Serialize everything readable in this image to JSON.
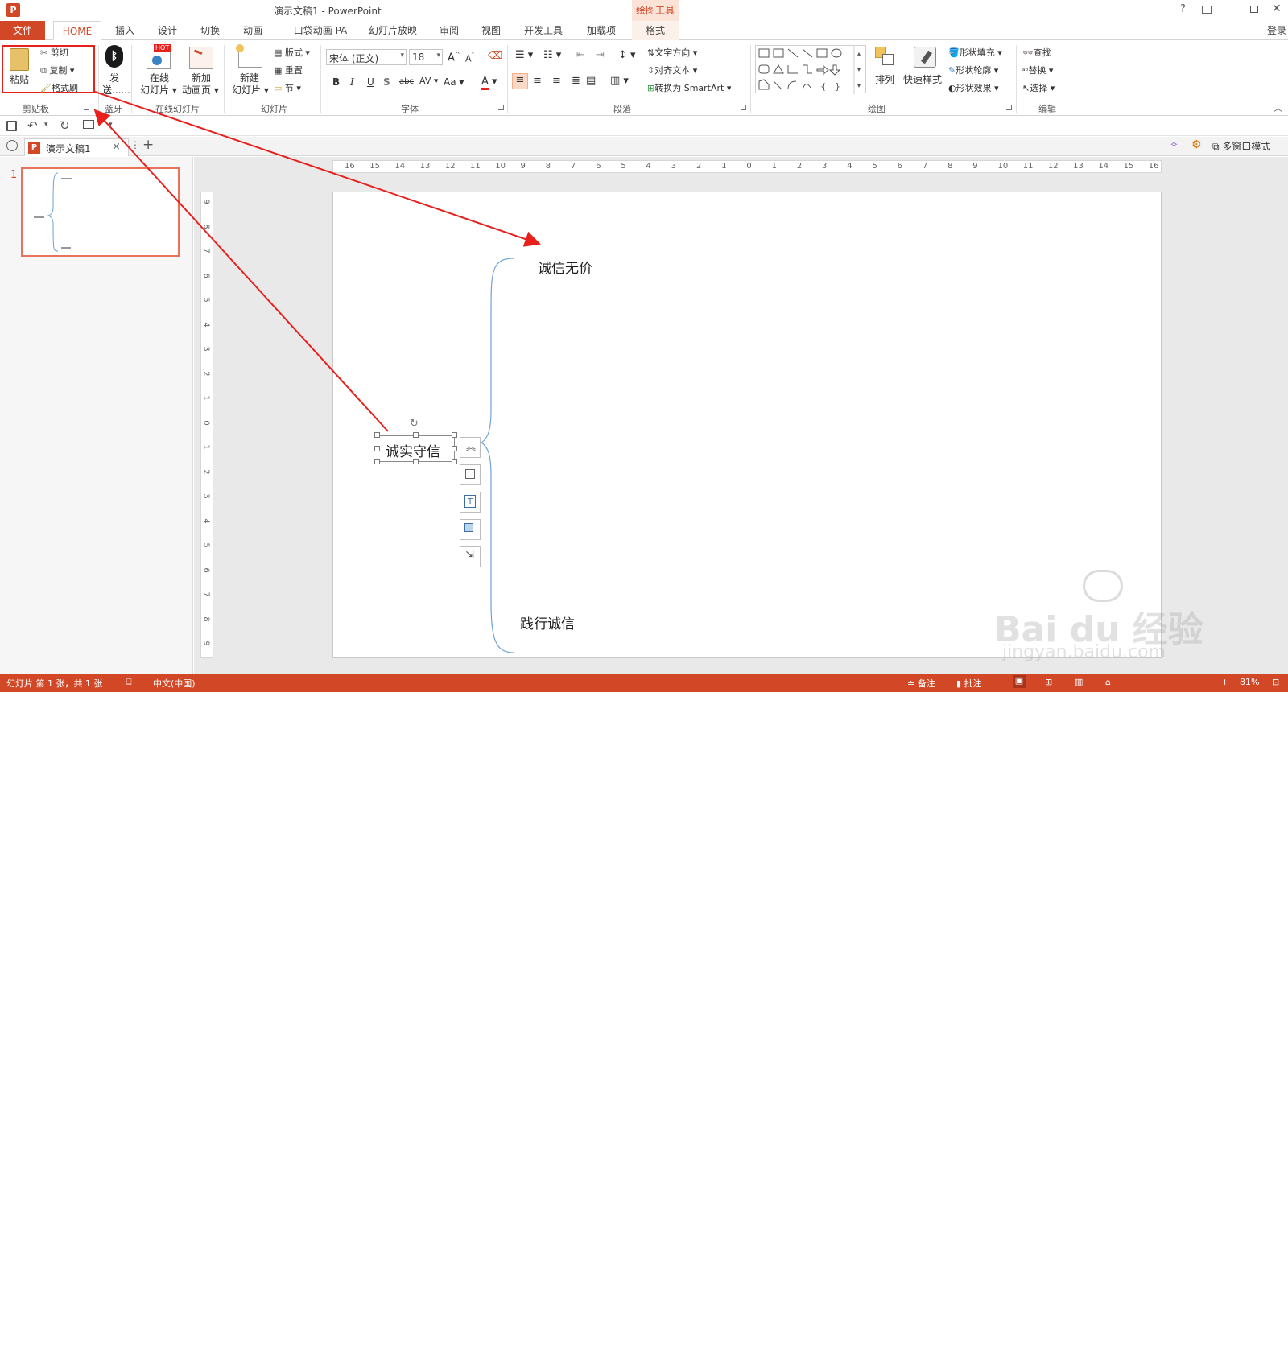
{
  "titlebar": {
    "app_title": "演示文稿1 - PowerPoint",
    "context_group": "绘图工具",
    "help": "?",
    "login": "登录"
  },
  "tabs": {
    "file": "文件",
    "items": [
      "HOME",
      "插入",
      "设计",
      "切换",
      "动画",
      "口袋动画 PA",
      "幻灯片放映",
      "审阅",
      "视图",
      "开发工具",
      "加载项",
      "格式"
    ]
  },
  "ribbon": {
    "clipboard": {
      "paste": "粘贴",
      "cut": "剪切",
      "copy": "复制",
      "format_painter": "格式刷",
      "label": "剪贴板"
    },
    "bluetooth": {
      "send": "发",
      "send2": "送......",
      "label": "蓝牙"
    },
    "online": {
      "online_slides": "在线",
      "online_slides2": "幻灯片",
      "new_anim": "新加",
      "new_anim2": "动画页",
      "badge": "HOT",
      "label": "在线幻灯片"
    },
    "slides": {
      "new_slide": "新建",
      "new_slide2": "幻灯片",
      "layout": "版式",
      "reset": "重置",
      "section": "节",
      "label": "幻灯片"
    },
    "font": {
      "name": "宋体 (正文)",
      "size": "18",
      "bold": "B",
      "italic": "I",
      "underline": "U",
      "strike": "abc",
      "spacing": "AV",
      "case": "Aa",
      "color": "A",
      "label": "字体"
    },
    "paragraph": {
      "text_direction": "文字方向",
      "align_text": "对齐文本",
      "smartart": "转换为 SmartArt",
      "label": "段落"
    },
    "drawing": {
      "arrange": "排列",
      "quick_styles": "快速样式",
      "fill": "形状填充",
      "outline": "形状轮廓",
      "effects": "形状效果",
      "label": "绘图"
    },
    "editing": {
      "find": "查找",
      "replace": "替换",
      "select": "选择",
      "label": "编辑"
    }
  },
  "doctabs": {
    "doc_name": "演示文稿1",
    "close": "×",
    "add": "+",
    "multiwindow": "多窗口模式"
  },
  "thumbnail": {
    "slide_number": "1"
  },
  "ruler": {
    "h_ticks": [
      "16",
      "15",
      "14",
      "13",
      "12",
      "11",
      "10",
      "9",
      "8",
      "7",
      "6",
      "5",
      "4",
      "3",
      "2",
      "1",
      "0",
      "1",
      "2",
      "3",
      "4",
      "5",
      "6",
      "7",
      "8",
      "9",
      "10",
      "11",
      "12",
      "13",
      "14",
      "15",
      "16"
    ],
    "v_ticks": [
      "9",
      "8",
      "7",
      "6",
      "5",
      "4",
      "3",
      "2",
      "1",
      "0",
      "1",
      "2",
      "3",
      "4",
      "5",
      "6",
      "7",
      "8",
      "9"
    ]
  },
  "slide": {
    "center_node": "诚实守信",
    "top_node": "诚信无价",
    "bottom_node": "践行诚信"
  },
  "status": {
    "slide_info": "幻灯片 第 1 张，共 1 张",
    "language": "中文(中国)",
    "notes": "备注",
    "comments": "批注",
    "zoom": "81%"
  },
  "watermark": {
    "brand": "Bai du 经验",
    "url": "jingyan.baidu.com"
  },
  "colors": {
    "accent": "#d24726",
    "annotation": "#e8201c",
    "brace": "#6ea2d6"
  }
}
